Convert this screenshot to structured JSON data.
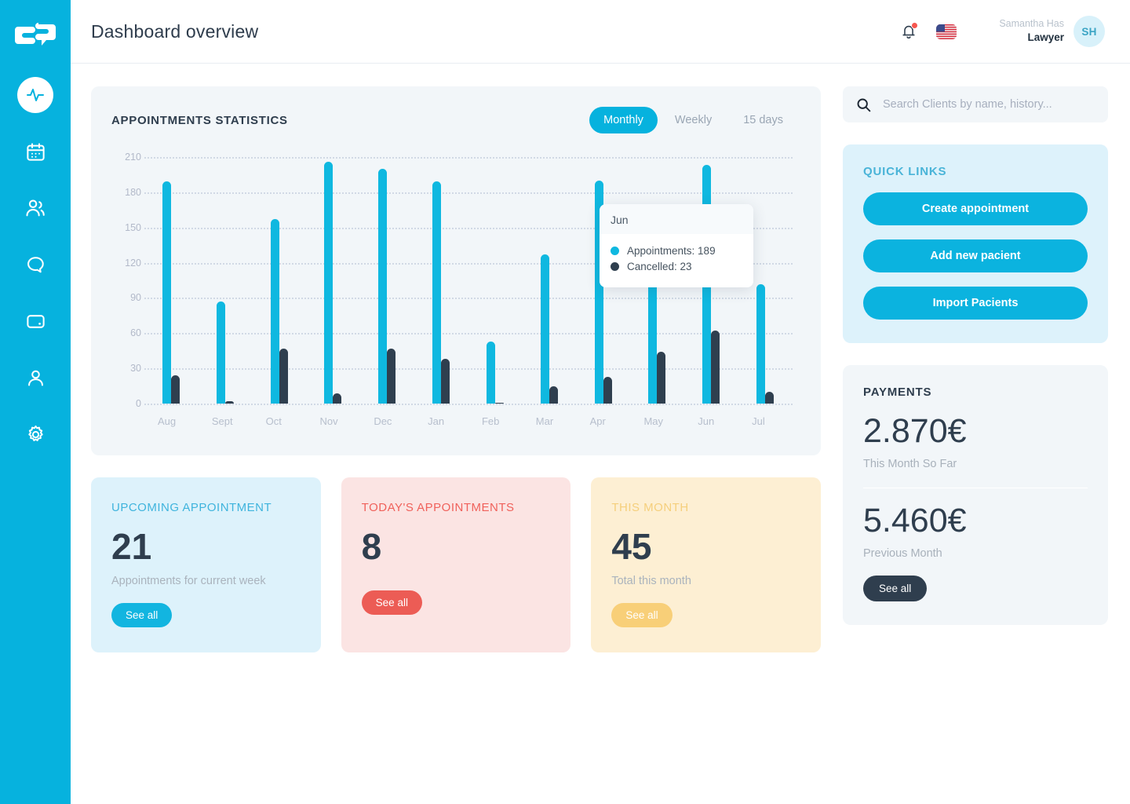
{
  "sidebar": {
    "logo_name": "chat-logo",
    "items": [
      {
        "name": "activity-pulse",
        "active": true
      },
      {
        "name": "calendar",
        "active": false
      },
      {
        "name": "patients-group",
        "active": false
      },
      {
        "name": "messages-bubble",
        "active": false
      },
      {
        "name": "wallet",
        "active": false
      },
      {
        "name": "profile-person",
        "active": false
      },
      {
        "name": "settings-gear",
        "active": false
      }
    ]
  },
  "header": {
    "title": "Dashboard overview",
    "notification_icon": "bell-icon",
    "has_notification": true,
    "language_flag": "us-flag",
    "user_name": "Samantha Has",
    "user_role": "Lawyer",
    "avatar_initials": "SH"
  },
  "chart_card": {
    "title": "APPOINTMENTS STATISTICS",
    "range_tabs": [
      {
        "label": "Monthly",
        "active": true
      },
      {
        "label": "Weekly",
        "active": false
      },
      {
        "label": "15 days",
        "active": false
      }
    ],
    "tooltip": {
      "month": "Jun",
      "rows": [
        {
          "label": "Appointments: 189",
          "color": "#0FB8E0"
        },
        {
          "label": "Cancelled: 23",
          "color": "#2f3f4f"
        }
      ]
    }
  },
  "chart_data": {
    "type": "bar",
    "title": "APPOINTMENTS STATISTICS",
    "xlabel": "",
    "ylabel": "",
    "ylim": [
      0,
      210
    ],
    "yticks": [
      0,
      30,
      60,
      90,
      120,
      150,
      180,
      210
    ],
    "grid": true,
    "legend_position": "tooltip",
    "categories": [
      "Aug",
      "Sept",
      "Oct",
      "Nov",
      "Dec",
      "Jan",
      "Feb",
      "Mar",
      "Apr",
      "May",
      "Jun",
      "Jul"
    ],
    "series": [
      {
        "name": "Appointments",
        "color": "#0FB8E0",
        "values": [
          189,
          87,
          157,
          206,
          200,
          189,
          53,
          127,
          190,
          170,
          203,
          102
        ]
      },
      {
        "name": "Cancelled",
        "color": "#2f3f4f",
        "values": [
          24,
          2,
          47,
          9,
          47,
          38,
          1,
          15,
          23,
          44,
          62,
          10
        ]
      }
    ]
  },
  "stats": [
    {
      "label": "UPCOMING APPOINTMENT",
      "value": "21",
      "sub": "Appointments for current week",
      "button": "See all",
      "theme": "blue"
    },
    {
      "label": "TODAY'S APPOINTMENTS",
      "value": "8",
      "sub": "",
      "button": "See all",
      "theme": "red"
    },
    {
      "label": "THIS MONTH",
      "value": "45",
      "sub": "Total this month",
      "button": "See all",
      "theme": "yellow"
    }
  ],
  "search": {
    "placeholder": "Search Clients by name, history...",
    "value": "",
    "icon": "search-icon"
  },
  "quick_links": {
    "title": "QUICK LINKS",
    "buttons": [
      "Create appointment",
      "Add new pacient",
      "Import Pacients"
    ]
  },
  "payments": {
    "title": "PAYMENTS",
    "current_value": "2.870€",
    "current_label": "This Month So Far",
    "previous_value": "5.460€",
    "previous_label": "Previous Month",
    "button": "See all"
  },
  "colors": {
    "accent": "#06B2DE",
    "bar_appointments": "#0FB8E0",
    "bar_cancelled": "#2f3f4f",
    "dark": "#2f3e4e",
    "red": "#ec5c55",
    "yellow": "#f8cf78"
  }
}
